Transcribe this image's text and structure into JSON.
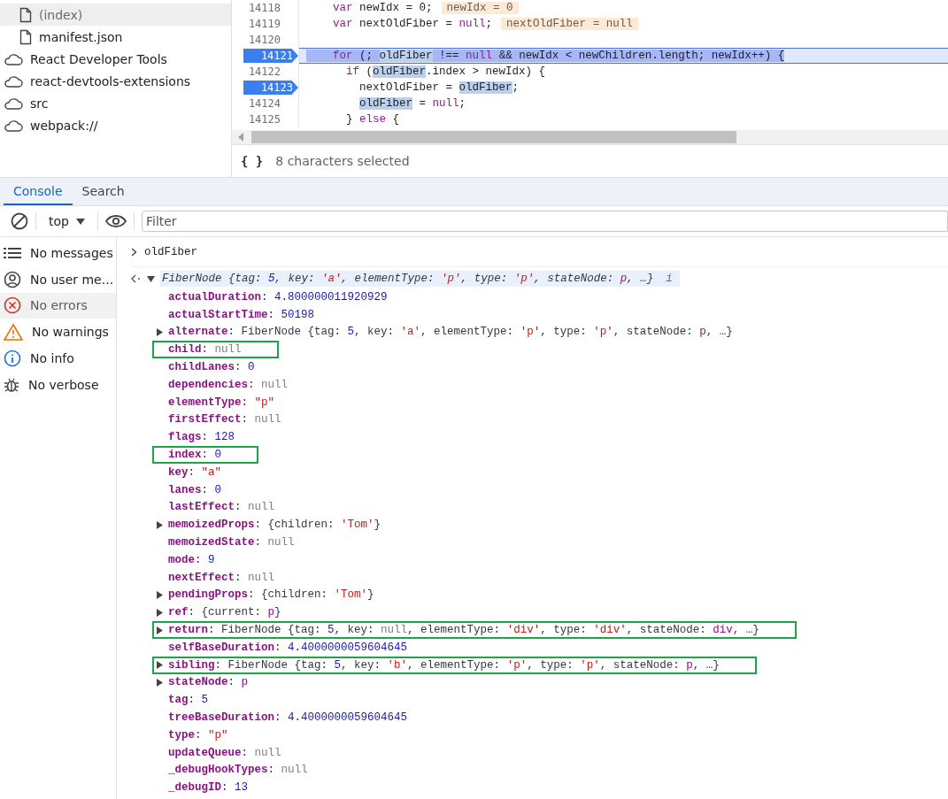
{
  "file_tree": [
    {
      "label": "(index)",
      "kind": "file",
      "selected": true
    },
    {
      "label": "manifest.json",
      "kind": "file",
      "selected": false
    },
    {
      "label": "React Developer Tools",
      "kind": "cloud",
      "selected": false
    },
    {
      "label": "react-devtools-extensions",
      "kind": "cloud",
      "selected": false
    },
    {
      "label": "src",
      "kind": "cloud",
      "selected": false
    },
    {
      "label": "webpack://",
      "kind": "cloud",
      "selected": false
    }
  ],
  "code_lines": [
    {
      "number": "14118",
      "breakpoint": false,
      "current": false,
      "tokens": [
        {
          "kind": "kw",
          "text": "    var"
        },
        {
          "kind": "text",
          "text": " newIdx = 0;"
        }
      ],
      "inline_value": "newIdx = 0"
    },
    {
      "number": "14119",
      "breakpoint": false,
      "current": false,
      "tokens": [
        {
          "kind": "kw",
          "text": "    var"
        },
        {
          "kind": "text",
          "text": " nextOldFiber = "
        },
        {
          "kind": "kw",
          "text": "null"
        },
        {
          "kind": "text",
          "text": ";"
        }
      ],
      "inline_value": "nextOldFiber = null"
    },
    {
      "number": "14120",
      "breakpoint": false,
      "current": false
    },
    {
      "number": "14121",
      "breakpoint": true,
      "current": true,
      "tokens": [
        {
          "kind": "kw",
          "text": "    for"
        },
        {
          "kind": "text",
          "text": " (; "
        },
        {
          "kind": "match",
          "text": "oldFiber"
        },
        {
          "kind": "text",
          "text": " !== "
        },
        {
          "kind": "kw",
          "text": "null"
        },
        {
          "kind": "text",
          "text": " && newIdx < newChildren.length; newIdx++) {"
        }
      ]
    },
    {
      "number": "14122",
      "breakpoint": false,
      "current": false,
      "tokens": [
        {
          "kind": "kw",
          "text": "      if"
        },
        {
          "kind": "text",
          "text": " ("
        },
        {
          "kind": "match",
          "text": "oldFiber"
        },
        {
          "kind": "text",
          "text": ".index > newIdx) {"
        }
      ]
    },
    {
      "number": "14123",
      "breakpoint": true,
      "current": false,
      "tokens": [
        {
          "kind": "text",
          "text": "        nextOldFiber = "
        },
        {
          "kind": "match",
          "text": "oldFiber"
        },
        {
          "kind": "text",
          "text": ";"
        }
      ]
    },
    {
      "number": "14124",
      "breakpoint": false,
      "current": false,
      "tokens": [
        {
          "kind": "match",
          "text": "        oldFiber"
        },
        {
          "kind": "text",
          "text": " = "
        },
        {
          "kind": "kw",
          "text": "null"
        },
        {
          "kind": "text",
          "text": ";"
        }
      ]
    },
    {
      "number": "14125",
      "breakpoint": false,
      "current": false,
      "tokens": [
        {
          "kind": "text",
          "text": "      } "
        },
        {
          "kind": "kw",
          "text": "else"
        },
        {
          "kind": "text",
          "text": " {"
        }
      ]
    }
  ],
  "editor_status": {
    "format_button": "{ }",
    "text": "8 characters selected"
  },
  "drawer_tabs": [
    {
      "label": "Console",
      "selected": true
    },
    {
      "label": "Search",
      "selected": false
    }
  ],
  "console_toolbar": {
    "context": "top",
    "filter": {
      "placeholder": "Filter"
    }
  },
  "console_sidebar": [
    {
      "label": "No messages",
      "kind": "list",
      "selected": false
    },
    {
      "label": "No user me...",
      "kind": "user",
      "selected": false
    },
    {
      "label": "No errors",
      "kind": "error",
      "selected": true
    },
    {
      "label": "No warnings",
      "kind": "warning",
      "selected": false
    },
    {
      "label": "No info",
      "kind": "info",
      "selected": false
    },
    {
      "label": "No verbose",
      "kind": "verbose",
      "selected": false
    }
  ],
  "console_input": "oldFiber",
  "result": {
    "summary": [
      {
        "kind": "plain",
        "text": "FiberNode {tag: "
      },
      {
        "kind": "num",
        "text": "5"
      },
      {
        "kind": "plain",
        "text": ", key: "
      },
      {
        "kind": "str",
        "text": "'a'"
      },
      {
        "kind": "plain",
        "text": ", elementType: "
      },
      {
        "kind": "str",
        "text": "'p'"
      },
      {
        "kind": "plain",
        "text": ", type: "
      },
      {
        "kind": "str",
        "text": "'p'"
      },
      {
        "kind": "plain",
        "text": ", stateNode: "
      },
      {
        "kind": "node",
        "text": "p"
      },
      {
        "kind": "plain",
        "text": ", …}"
      }
    ],
    "info_badge": "i",
    "expanded": true,
    "properties": [
      {
        "name": "actualDuration",
        "expandable": false,
        "highlighted": false,
        "value": [
          {
            "kind": "plain",
            "text": ": "
          },
          {
            "kind": "num",
            "text": "4.800000011920929"
          }
        ]
      },
      {
        "name": "actualStartTime",
        "expandable": false,
        "highlighted": false,
        "value": [
          {
            "kind": "plain",
            "text": ": "
          },
          {
            "kind": "num",
            "text": "50198"
          }
        ]
      },
      {
        "name": "alternate",
        "expandable": true,
        "highlighted": false,
        "value": [
          {
            "kind": "plain",
            "text": ": FiberNode {tag: "
          },
          {
            "kind": "num",
            "text": "5"
          },
          {
            "kind": "plain",
            "text": ", key: "
          },
          {
            "kind": "str",
            "text": "'a'"
          },
          {
            "kind": "plain",
            "text": ", elementType: "
          },
          {
            "kind": "str",
            "text": "'p'"
          },
          {
            "kind": "plain",
            "text": ", type: "
          },
          {
            "kind": "str",
            "text": "'p'"
          },
          {
            "kind": "plain",
            "text": ", stateNode: "
          },
          {
            "kind": "node",
            "text": "p"
          },
          {
            "kind": "plain",
            "text": ", …}"
          }
        ]
      },
      {
        "name": "child",
        "expandable": false,
        "highlighted": true,
        "value": [
          {
            "kind": "plain",
            "text": ": "
          },
          {
            "kind": "null",
            "text": "null"
          }
        ]
      },
      {
        "name": "childLanes",
        "expandable": false,
        "highlighted": false,
        "value": [
          {
            "kind": "plain",
            "text": ": "
          },
          {
            "kind": "num",
            "text": "0"
          }
        ]
      },
      {
        "name": "dependencies",
        "expandable": false,
        "highlighted": false,
        "value": [
          {
            "kind": "plain",
            "text": ": "
          },
          {
            "kind": "null",
            "text": "null"
          }
        ]
      },
      {
        "name": "elementType",
        "expandable": false,
        "highlighted": false,
        "value": [
          {
            "kind": "plain",
            "text": ": "
          },
          {
            "kind": "str",
            "text": "\"p\""
          }
        ]
      },
      {
        "name": "firstEffect",
        "expandable": false,
        "highlighted": false,
        "value": [
          {
            "kind": "plain",
            "text": ": "
          },
          {
            "kind": "null",
            "text": "null"
          }
        ]
      },
      {
        "name": "flags",
        "expandable": false,
        "highlighted": false,
        "value": [
          {
            "kind": "plain",
            "text": ": "
          },
          {
            "kind": "num",
            "text": "128"
          }
        ]
      },
      {
        "name": "index",
        "expandable": false,
        "highlighted": true,
        "value": [
          {
            "kind": "plain",
            "text": ": "
          },
          {
            "kind": "num",
            "text": "0"
          }
        ]
      },
      {
        "name": "key",
        "expandable": false,
        "highlighted": false,
        "value": [
          {
            "kind": "plain",
            "text": ": "
          },
          {
            "kind": "str",
            "text": "\"a\""
          }
        ]
      },
      {
        "name": "lanes",
        "expandable": false,
        "highlighted": false,
        "value": [
          {
            "kind": "plain",
            "text": ": "
          },
          {
            "kind": "num",
            "text": "0"
          }
        ]
      },
      {
        "name": "lastEffect",
        "expandable": false,
        "highlighted": false,
        "value": [
          {
            "kind": "plain",
            "text": ": "
          },
          {
            "kind": "null",
            "text": "null"
          }
        ]
      },
      {
        "name": "memoizedProps",
        "expandable": true,
        "highlighted": false,
        "value": [
          {
            "kind": "plain",
            "text": ": {children: "
          },
          {
            "kind": "str",
            "text": "'Tom'"
          },
          {
            "kind": "plain",
            "text": "}"
          }
        ]
      },
      {
        "name": "memoizedState",
        "expandable": false,
        "highlighted": false,
        "value": [
          {
            "kind": "plain",
            "text": ": "
          },
          {
            "kind": "null",
            "text": "null"
          }
        ]
      },
      {
        "name": "mode",
        "expandable": false,
        "highlighted": false,
        "value": [
          {
            "kind": "plain",
            "text": ": "
          },
          {
            "kind": "num",
            "text": "9"
          }
        ]
      },
      {
        "name": "nextEffect",
        "expandable": false,
        "highlighted": false,
        "value": [
          {
            "kind": "plain",
            "text": ": "
          },
          {
            "kind": "null",
            "text": "null"
          }
        ]
      },
      {
        "name": "pendingProps",
        "expandable": true,
        "highlighted": false,
        "value": [
          {
            "kind": "plain",
            "text": ": {children: "
          },
          {
            "kind": "str",
            "text": "'Tom'"
          },
          {
            "kind": "plain",
            "text": "}"
          }
        ]
      },
      {
        "name": "ref",
        "expandable": true,
        "highlighted": false,
        "value": [
          {
            "kind": "plain",
            "text": ": {current: "
          },
          {
            "kind": "node",
            "text": "p"
          },
          {
            "kind": "plain",
            "text": "}"
          }
        ]
      },
      {
        "name": "return",
        "expandable": true,
        "highlighted": true,
        "value": [
          {
            "kind": "plain",
            "text": ": FiberNode {tag: "
          },
          {
            "kind": "num",
            "text": "5"
          },
          {
            "kind": "plain",
            "text": ", key: "
          },
          {
            "kind": "null",
            "text": "null"
          },
          {
            "kind": "plain",
            "text": ", elementType: "
          },
          {
            "kind": "str",
            "text": "'div'"
          },
          {
            "kind": "plain",
            "text": ", type: "
          },
          {
            "kind": "str",
            "text": "'div'"
          },
          {
            "kind": "plain",
            "text": ", stateNode: "
          },
          {
            "kind": "node",
            "text": "div"
          },
          {
            "kind": "plain",
            "text": ", …}"
          }
        ]
      },
      {
        "name": "selfBaseDuration",
        "expandable": false,
        "highlighted": false,
        "value": [
          {
            "kind": "plain",
            "text": ": "
          },
          {
            "kind": "num",
            "text": "4.4000000059604645"
          }
        ]
      },
      {
        "name": "sibling",
        "expandable": true,
        "highlighted": true,
        "value": [
          {
            "kind": "plain",
            "text": ": FiberNode {tag: "
          },
          {
            "kind": "num",
            "text": "5"
          },
          {
            "kind": "plain",
            "text": ", key: "
          },
          {
            "kind": "str",
            "text": "'b'"
          },
          {
            "kind": "plain",
            "text": ", elementType: "
          },
          {
            "kind": "str",
            "text": "'p'"
          },
          {
            "kind": "plain",
            "text": ", type: "
          },
          {
            "kind": "str",
            "text": "'p'"
          },
          {
            "kind": "plain",
            "text": ", stateNode: "
          },
          {
            "kind": "node",
            "text": "p"
          },
          {
            "kind": "plain",
            "text": ", …}"
          }
        ]
      },
      {
        "name": "stateNode",
        "expandable": true,
        "highlighted": false,
        "value": [
          {
            "kind": "plain",
            "text": ": "
          },
          {
            "kind": "node",
            "text": "p"
          }
        ]
      },
      {
        "name": "tag",
        "expandable": false,
        "highlighted": false,
        "value": [
          {
            "kind": "plain",
            "text": ": "
          },
          {
            "kind": "num",
            "text": "5"
          }
        ]
      },
      {
        "name": "treeBaseDuration",
        "expandable": false,
        "highlighted": false,
        "value": [
          {
            "kind": "plain",
            "text": ": "
          },
          {
            "kind": "num",
            "text": "4.4000000059604645"
          }
        ]
      },
      {
        "name": "type",
        "expandable": false,
        "highlighted": false,
        "value": [
          {
            "kind": "plain",
            "text": ": "
          },
          {
            "kind": "str",
            "text": "\"p\""
          }
        ]
      },
      {
        "name": "updateQueue",
        "expandable": false,
        "highlighted": false,
        "value": [
          {
            "kind": "plain",
            "text": ": "
          },
          {
            "kind": "null",
            "text": "null"
          }
        ]
      },
      {
        "name": "_debugHookTypes",
        "expandable": false,
        "highlighted": false,
        "value": [
          {
            "kind": "plain",
            "text": ": "
          },
          {
            "kind": "null",
            "text": "null"
          }
        ]
      },
      {
        "name": "_debugID",
        "expandable": false,
        "highlighted": false,
        "value": [
          {
            "kind": "plain",
            "text": ": "
          },
          {
            "kind": "num",
            "text": "13"
          }
        ]
      }
    ]
  }
}
